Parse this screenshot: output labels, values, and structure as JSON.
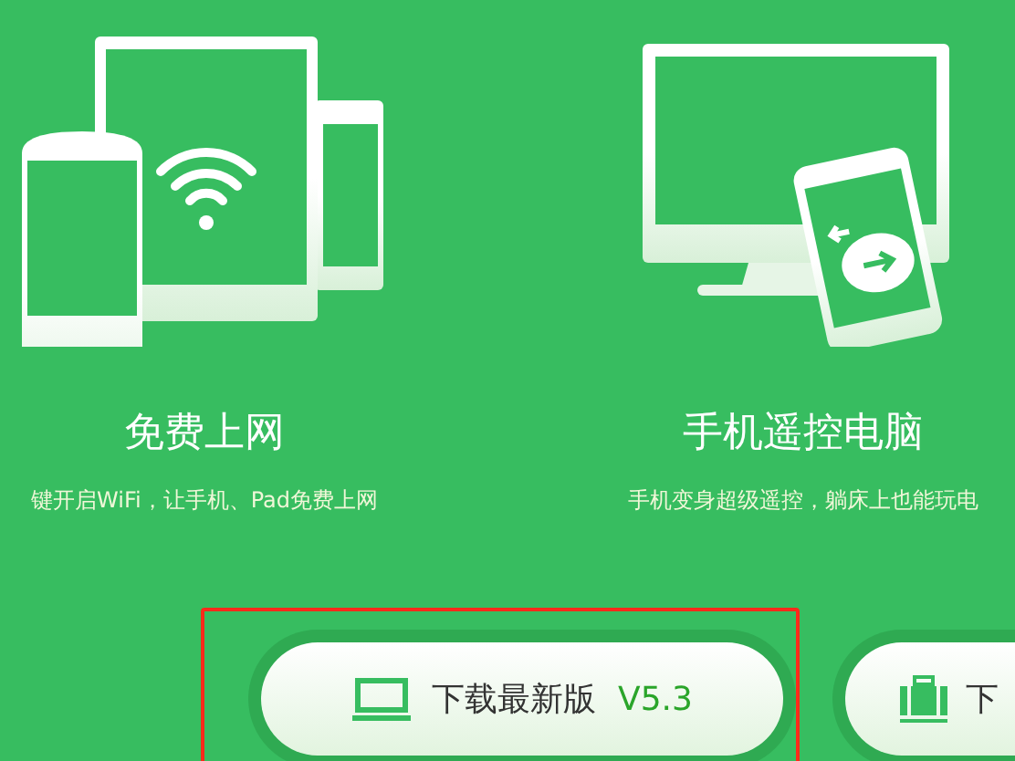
{
  "features": [
    {
      "kind": "wifi",
      "title": "免费上网",
      "subtitle": "键开启WiFi，让手机、Pad免费上网"
    },
    {
      "kind": "remote",
      "title": "手机遥控电脑",
      "subtitle": "手机变身超级遥控，躺床上也能玩电"
    }
  ],
  "downloads": [
    {
      "kind": "laptop",
      "label": "下载最新版",
      "version": "V5.3",
      "highlighted": true
    },
    {
      "kind": "bag",
      "label": "下",
      "highlighted": false
    }
  ]
}
